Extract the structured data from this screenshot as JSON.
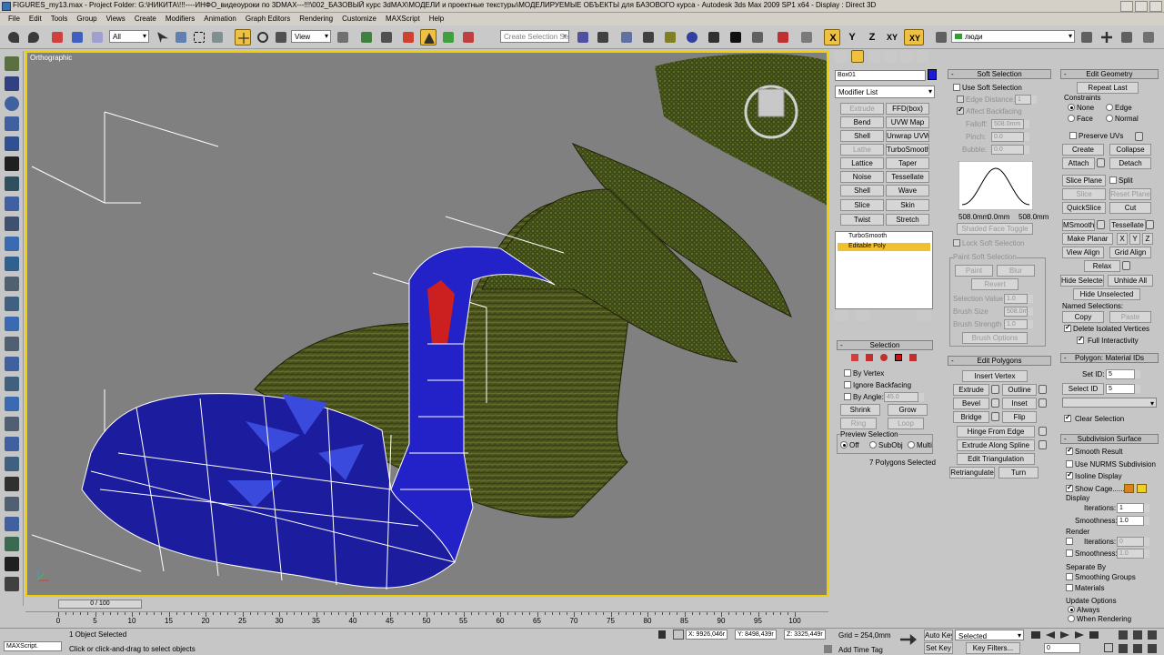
{
  "window": {
    "title": "FIGURES_my13.max   - Project Folder: G:\\НИКИТА\\!!!----ИНФО_видеоуроки по 3DMAX---!!!\\002_БАЗОВЫЙ курс 3dMAX\\МОДЕЛИ и проектные текстуры\\МОДЕЛИРУЕМЫЕ ОБЪЕКТЫ для БАЗОВОГО курса   - Autodesk 3ds Max  2009 SP1  x64     - Display : Direct 3D"
  },
  "menu": [
    "File",
    "Edit",
    "Tools",
    "Group",
    "Views",
    "Create",
    "Modifiers",
    "Animation",
    "Graph Editors",
    "Rendering",
    "Customize",
    "MAXScript",
    "Help"
  ],
  "toolbar": {
    "filter": "All",
    "ref_coord": "View",
    "named_sel": "Create Selection Set",
    "axes": [
      "X",
      "Y",
      "Z",
      "XY",
      "XY"
    ],
    "layer": "люди"
  },
  "viewport": {
    "label": "Orthographic"
  },
  "command_panel": {
    "object_name": "Box01",
    "object_color": "#1a1ad8",
    "modifier_list": "Modifier List",
    "mod_buttons": [
      [
        "Extrude",
        "FFD(box)"
      ],
      [
        "Bend",
        "UVW Map"
      ],
      [
        "Shell",
        "Unwrap UVW"
      ],
      [
        "Lathe",
        "TurboSmooth"
      ],
      [
        "Lattice",
        "Taper"
      ],
      [
        "Noise",
        "Tessellate"
      ],
      [
        "Shell",
        "Wave"
      ],
      [
        "Slice",
        "Skin"
      ],
      [
        "Twist",
        "Stretch"
      ]
    ],
    "stack": [
      "TurboSmooth",
      "Editable Poly"
    ]
  },
  "selection": {
    "title": "Selection",
    "by_vertex": "By Vertex",
    "ignore_backfacing": "Ignore Backfacing",
    "by_angle": "By Angle:",
    "angle": "45.0",
    "shrink": "Shrink",
    "grow": "Grow",
    "ring": "Ring",
    "loop": "Loop",
    "preview_title": "Preview Selection",
    "preview_opts": [
      "Off",
      "SubObj",
      "Multi"
    ],
    "status": "7 Polygons Selected"
  },
  "soft_selection": {
    "title": "Soft Selection",
    "use": "Use Soft Selection",
    "edge_distance": "Edge Distance:",
    "edge_value": "1",
    "affect_backfacing": "Affect Backfacing",
    "falloff_label": "Falloff:",
    "falloff": "508.0mm",
    "pinch_label": "Pinch:",
    "pinch": "0.0",
    "bubble_label": "Bubble:",
    "bubble": "0.0",
    "curve_left": "508.0mm",
    "curve_mid": "0.0mm",
    "curve_right": "508.0mm",
    "shaded": "Shaded Face Toggle",
    "lock": "Lock Soft Selection",
    "paint_title": "Paint Soft Selection",
    "paint": "Paint",
    "blur": "Blur",
    "revert": "Revert",
    "sel_value_label": "Selection Value",
    "sel_value": "1.0",
    "brush_size_label": "Brush Size",
    "brush_size": "508.0m",
    "brush_strength_label": "Brush Strength",
    "brush_strength": "1.0",
    "brush_options": "Brush Options"
  },
  "edit_polygons": {
    "title": "Edit Polygons",
    "insert_vertex": "Insert Vertex",
    "rows": [
      [
        "Extrude",
        "Outline"
      ],
      [
        "Bevel",
        "Inset"
      ],
      [
        "Bridge",
        "Flip"
      ]
    ],
    "hinge": "Hinge From Edge",
    "extrude_spline": "Extrude Along Spline",
    "edit_tri": "Edit Triangulation",
    "retriangulate": "Retriangulate",
    "turn": "Turn"
  },
  "edit_geometry": {
    "title": "Edit Geometry",
    "repeat_last": "Repeat Last",
    "constraints": "Constraints",
    "c_opts": [
      "None",
      "Edge",
      "Face",
      "Normal"
    ],
    "preserve_uvs": "Preserve UVs",
    "create": "Create",
    "collapse": "Collapse",
    "attach": "Attach",
    "detach": "Detach",
    "slice_plane": "Slice Plane",
    "split": "Split",
    "slice": "Slice",
    "reset_plane": "Reset Plane",
    "quickslice": "QuickSlice",
    "cut": "Cut",
    "msmooth": "MSmooth",
    "tessellate": "Tessellate",
    "make_planar": "Make Planar",
    "x": "X",
    "y": "Y",
    "z": "Z",
    "view_align": "View Align",
    "grid_align": "Grid Align",
    "relax": "Relax",
    "hide_selected": "Hide Selected",
    "unhide_all": "Unhide All",
    "hide_unselected": "Hide Unselected",
    "named_selections": "Named Selections:",
    "copy": "Copy",
    "paste": "Paste",
    "delete_isolated": "Delete Isolated Vertices",
    "full_interactivity": "Full Interactivity"
  },
  "material_ids": {
    "title": "Polygon: Material IDs",
    "set_id": "Set ID:",
    "set_val": "5",
    "select_id": "Select ID",
    "select_val": "5",
    "clear_selection": "Clear Selection"
  },
  "subdivision": {
    "title": "Subdivision Surface",
    "smooth_result": "Smooth Result",
    "use_nurms": "Use NURMS Subdivision",
    "isoline": "Isoline Display",
    "show_cage": "Show Cage......",
    "display": "Display",
    "iterations": "Iterations:",
    "iter_val": "1",
    "smoothness": "Smoothness:",
    "smooth_val": "1.0",
    "render": "Render",
    "r_iter_val": "0",
    "r_smooth_val": "1.0",
    "separate_by": "Separate By",
    "smoothing_groups": "Smoothing Groups",
    "materials": "Materials",
    "update_options": "Update Options",
    "always": "Always",
    "when_rendering": "When Rendering"
  },
  "timeline": {
    "slider": "0 / 100",
    "ticks": [
      "0",
      "5",
      "10",
      "15",
      "20",
      "25",
      "30",
      "35",
      "40",
      "45",
      "50",
      "55",
      "60",
      "65",
      "70",
      "75",
      "80",
      "85",
      "90",
      "95",
      "100"
    ]
  },
  "status": {
    "maxscript": "MAXScript.",
    "objects": "1 Object Selected",
    "prompt": "Click or click-and-drag to select objects",
    "x": "X: 9926,046r",
    "y": "Y: 8498,439r",
    "z": "Z: 3325,449r",
    "grid": "Grid = 254,0mm",
    "add_time_tag": "Add Time Tag",
    "auto_key": "Auto Key",
    "selected": "Selected",
    "set_key": "Set Key",
    "key_filters": "Key Filters...",
    "frame": "0"
  }
}
